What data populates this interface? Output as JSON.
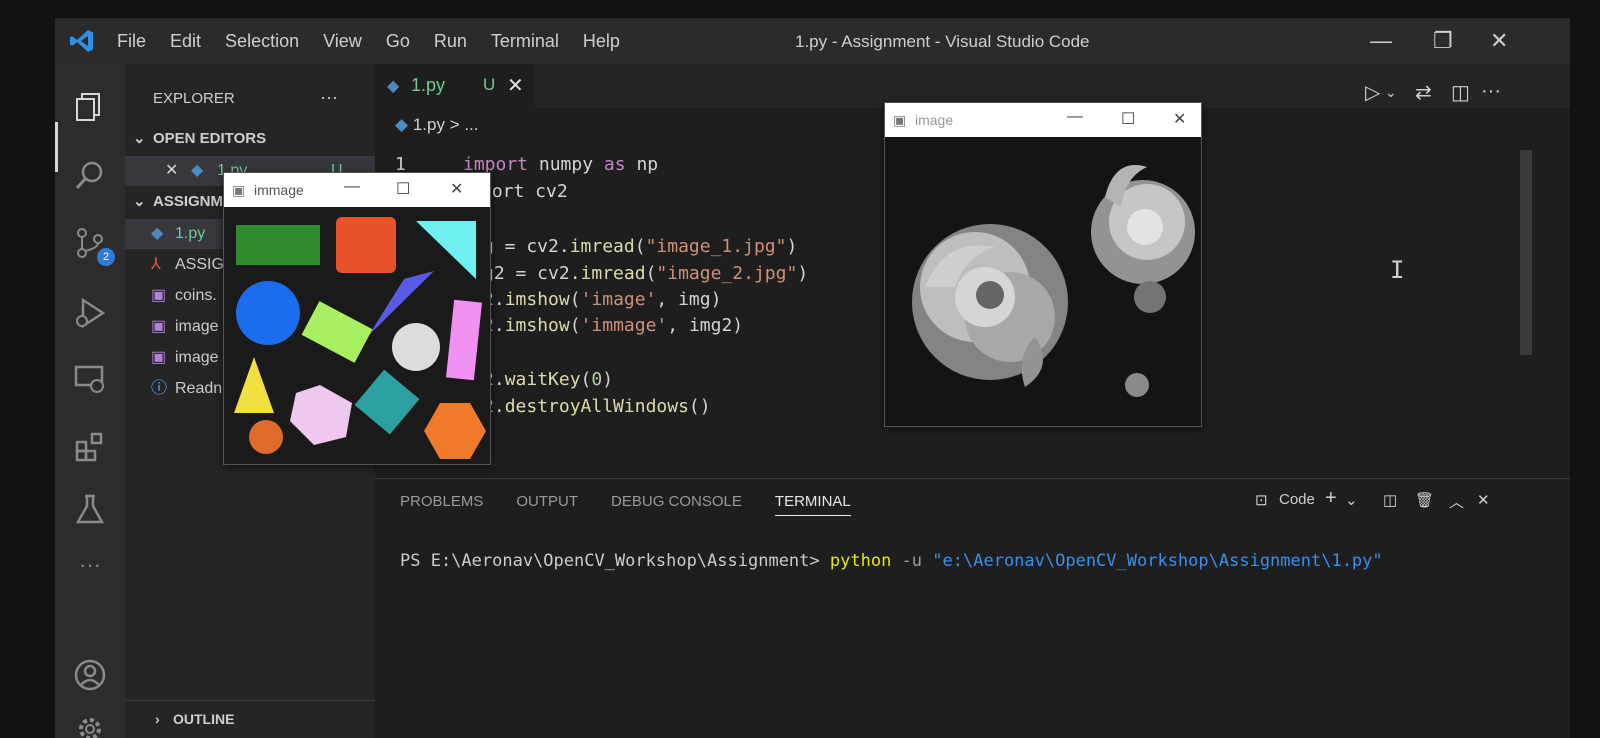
{
  "titlebar": {
    "menu": [
      "File",
      "Edit",
      "Selection",
      "View",
      "Go",
      "Run",
      "Terminal",
      "Help"
    ],
    "window_title": "1.py - Assignment - Visual Studio Code"
  },
  "activity_bar": {
    "scm_badge": "2"
  },
  "sidebar": {
    "header": "EXPLORER",
    "more": "···",
    "open_editors_label": "OPEN EDITORS",
    "open_editor": {
      "name": "1.py",
      "status": "U"
    },
    "folder_label": "ASSIGNM",
    "files": [
      "1.py",
      "ASSIG",
      "coins.",
      "image",
      "image",
      "Readn"
    ],
    "outline_label": "OUTLINE"
  },
  "editor": {
    "tab": {
      "name": "1.py",
      "status": "U"
    },
    "breadcrumb": "1.py > ...",
    "line1": {
      "number": "1",
      "kw1": "import",
      "mod": "numpy",
      "kw2": "as",
      "alias": "np"
    },
    "line2": {
      "text": "port cv2"
    },
    "line4": {
      "a": "g = cv2.",
      "fn": "imread",
      "b": "(",
      "s": "\"image_1.jpg\"",
      "c": ")"
    },
    "line5": {
      "a": "g2 = cv2.",
      "fn": "imread",
      "b": "(",
      "s": "\"image_2.jpg\"",
      "c": ")"
    },
    "line6": {
      "a": "2.",
      "fn": "imshow",
      "b": "(",
      "s": "'image'",
      "c": ", img)"
    },
    "line7": {
      "a": "2.",
      "fn": "imshow",
      "b": "(",
      "s": "'immage'",
      "c": ", img2)"
    },
    "line9": {
      "a": "2.",
      "fn": "waitKey",
      "b": "(",
      "n": "0",
      "c": ")"
    },
    "line10": {
      "a": "2.",
      "fn": "destroyAllWindows",
      "c": "()"
    }
  },
  "windows": {
    "shapes_title": "immage",
    "flower_title": "image"
  },
  "panel": {
    "tabs": [
      "PROBLEMS",
      "OUTPUT",
      "DEBUG CONSOLE",
      "TERMINAL"
    ],
    "terminal_profile": "Code",
    "prompt": "PS E:\\Aeronav\\OpenCV_Workshop\\Assignment>",
    "cmd": "python",
    "flag": "-u",
    "path": "\"e:\\Aeronav\\OpenCV_Workshop\\Assignment\\1.py\""
  },
  "colors": {
    "accent": "#2f7bd6",
    "keyword": "#c586c0",
    "function": "#dcdcaa",
    "string": "#ce9178",
    "terminal_cmd": "#e5e510",
    "terminal_path": "#3b8eea"
  }
}
